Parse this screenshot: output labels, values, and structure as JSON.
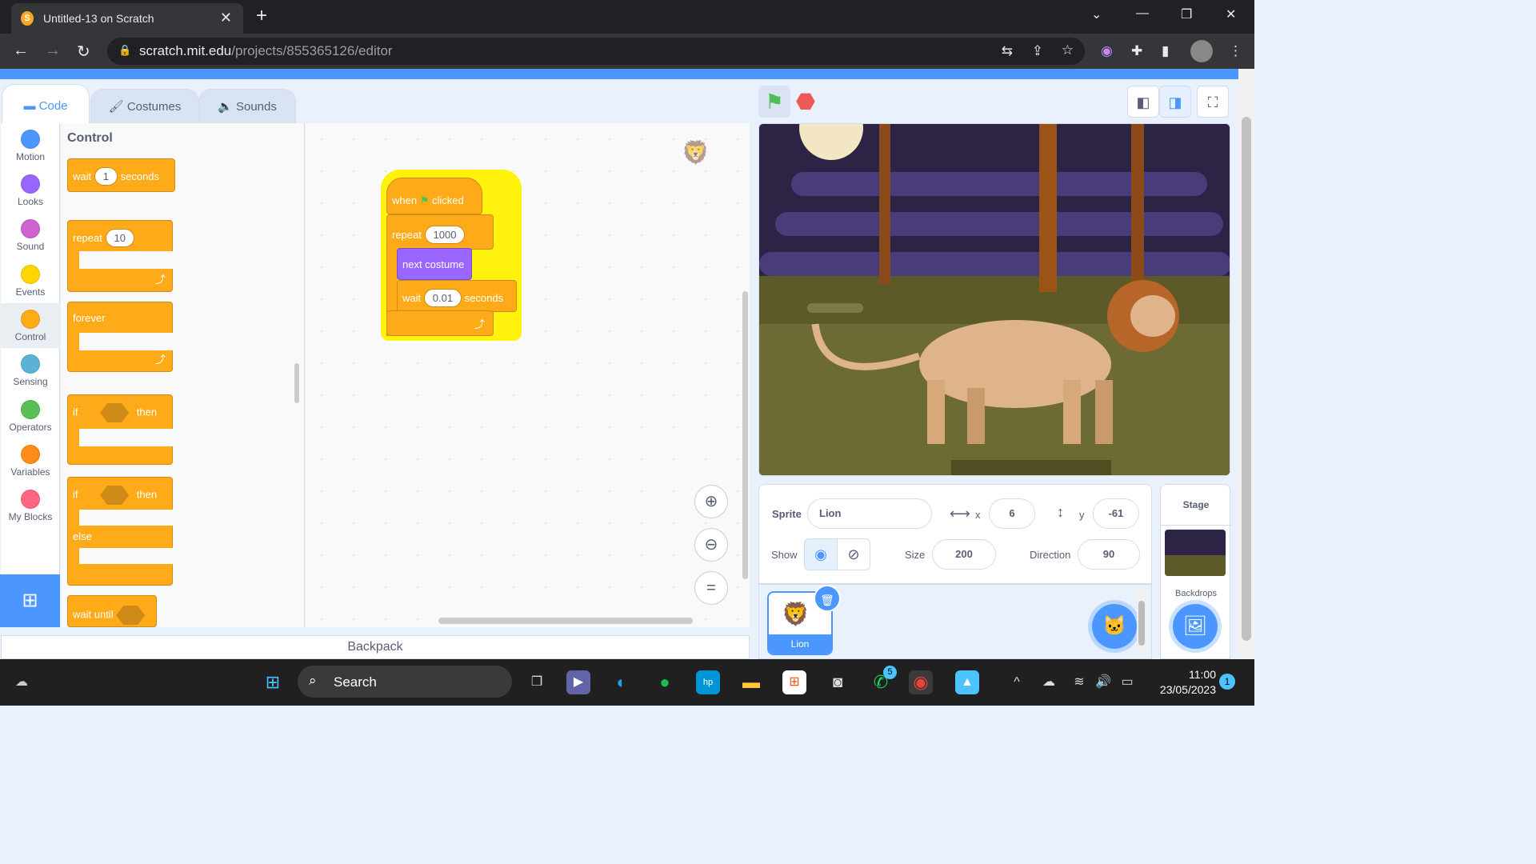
{
  "browser": {
    "tab_title": "Untitled-13 on Scratch",
    "url_host": "scratch.mit.edu",
    "url_path": "/projects/855365126/editor"
  },
  "editor_tabs": {
    "code": "Code",
    "costumes": "Costumes",
    "sounds": "Sounds"
  },
  "categories": [
    {
      "label": "Motion",
      "color": "#4c97ff"
    },
    {
      "label": "Looks",
      "color": "#9966ff"
    },
    {
      "label": "Sound",
      "color": "#cf63cf"
    },
    {
      "label": "Events",
      "color": "#ffd500"
    },
    {
      "label": "Control",
      "color": "#ffab19"
    },
    {
      "label": "Sensing",
      "color": "#5cb1d6"
    },
    {
      "label": "Operators",
      "color": "#59c059"
    },
    {
      "label": "Variables",
      "color": "#ff8c1a"
    },
    {
      "label": "My Blocks",
      "color": "#ff6680"
    }
  ],
  "palette": {
    "title": "Control",
    "wait": {
      "pre": "wait",
      "value": "1",
      "post": "seconds"
    },
    "repeat": {
      "pre": "repeat",
      "value": "10"
    },
    "forever": "forever",
    "if_then": {
      "pre": "if",
      "post": "then"
    },
    "if_else": {
      "pre": "if",
      "post": "then",
      "else": "else"
    },
    "wait_until": "wait until"
  },
  "script": {
    "when": "when",
    "clicked": "clicked",
    "repeat": "repeat",
    "repeat_value": "1000",
    "next_costume": "next costume",
    "wait": "wait",
    "wait_value": "0.01",
    "seconds": "seconds"
  },
  "backpack": "Backpack",
  "sprite_info": {
    "sprite_label": "Sprite",
    "sprite_name": "Lion",
    "x_label": "x",
    "x_value": "6",
    "y_label": "y",
    "y_value": "-61",
    "show_label": "Show",
    "size_label": "Size",
    "size_value": "200",
    "direction_label": "Direction",
    "direction_value": "90"
  },
  "sprite_list": [
    {
      "name": "Lion"
    }
  ],
  "stage_panel": {
    "title": "Stage",
    "backdrops_label": "Backdrops"
  },
  "taskbar": {
    "search": "Search",
    "time": "11:00",
    "date": "23/05/2023",
    "whatsapp_badge": "5",
    "notification_count": "1"
  }
}
